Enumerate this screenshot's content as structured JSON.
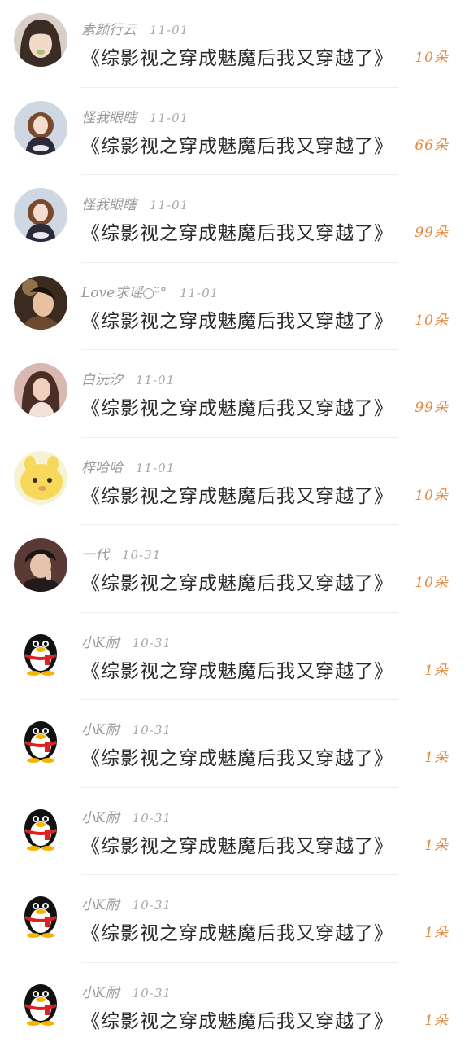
{
  "gifts": [
    {
      "name": "素颜行云",
      "date": "11-01",
      "title": "《综影视之穿成魅魔后我又穿越了》",
      "count": "10朵",
      "avatar": "girl-portrait-icon"
    },
    {
      "name": "怪我眼瞎",
      "date": "11-01",
      "title": "《综影视之穿成魅魔后我又穿越了》",
      "count": "66朵",
      "avatar": "anime-girl-icon"
    },
    {
      "name": "怪我眼瞎",
      "date": "11-01",
      "title": "《综影视之穿成魅魔后我又穿越了》",
      "count": "99朵",
      "avatar": "anime-girl-icon"
    },
    {
      "name": "Love求瑶○ᵕ̈°",
      "date": "11-01",
      "title": "《综影视之穿成魅魔后我又穿越了》",
      "count": "10朵",
      "avatar": "woman-photo-icon"
    },
    {
      "name": "白沅汐",
      "date": "11-01",
      "title": "《综影视之穿成魅魔后我又穿越了》",
      "count": "99朵",
      "avatar": "woman-photo-icon"
    },
    {
      "name": "梓哈哈",
      "date": "11-01",
      "title": "《综影视之穿成魅魔后我又穿越了》",
      "count": "10朵",
      "avatar": "yellow-cartoon-icon"
    },
    {
      "name": "一代",
      "date": "10-31",
      "title": "《综影视之穿成魅魔后我又穿越了》",
      "count": "10朵",
      "avatar": "man-portrait-icon"
    },
    {
      "name": "小K耐",
      "date": "10-31",
      "title": "《综影视之穿成魅魔后我又穿越了》",
      "count": "1朵",
      "avatar": "penguin-icon"
    },
    {
      "name": "小K耐",
      "date": "10-31",
      "title": "《综影视之穿成魅魔后我又穿越了》",
      "count": "1朵",
      "avatar": "penguin-icon"
    },
    {
      "name": "小K耐",
      "date": "10-31",
      "title": "《综影视之穿成魅魔后我又穿越了》",
      "count": "1朵",
      "avatar": "penguin-icon"
    },
    {
      "name": "小K耐",
      "date": "10-31",
      "title": "《综影视之穿成魅魔后我又穿越了》",
      "count": "1朵",
      "avatar": "penguin-icon"
    },
    {
      "name": "小K耐",
      "date": "10-31",
      "title": "《综影视之穿成魅魔后我又穿越了》",
      "count": "1朵",
      "avatar": "penguin-icon"
    }
  ],
  "colors": {
    "name": "#9a9a9a",
    "title": "#2a2a2a",
    "count": "#e4893c",
    "divider": "#eeeeee"
  }
}
